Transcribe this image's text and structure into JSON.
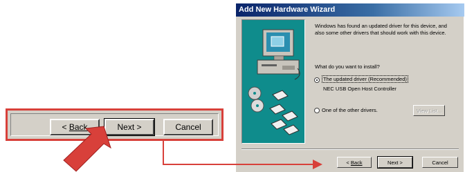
{
  "zoom": {
    "back_label": "Back",
    "back_prefix": "< ",
    "next_label": "Next >",
    "cancel_label": "Cancel"
  },
  "dialog": {
    "title": "Add New Hardware Wizard",
    "message_line1": "Windows has found an updated driver for this device, and",
    "message_line2": "also some other drivers that should work with this device.",
    "question": "What do you want to install?",
    "option_updated": "The updated driver (Recommended)",
    "option_updated_detail": "NEC USB Open Host Controller",
    "option_other": "One of the other drivers.",
    "view_list_label": "View List...",
    "back_label": "Back",
    "back_prefix": "< ",
    "next_label": "Next >",
    "cancel_label": "Cancel"
  },
  "colors": {
    "accent_red": "#d8403a",
    "panel_teal": "#0f8c8c",
    "titlebar_blue": "#0a246a"
  }
}
